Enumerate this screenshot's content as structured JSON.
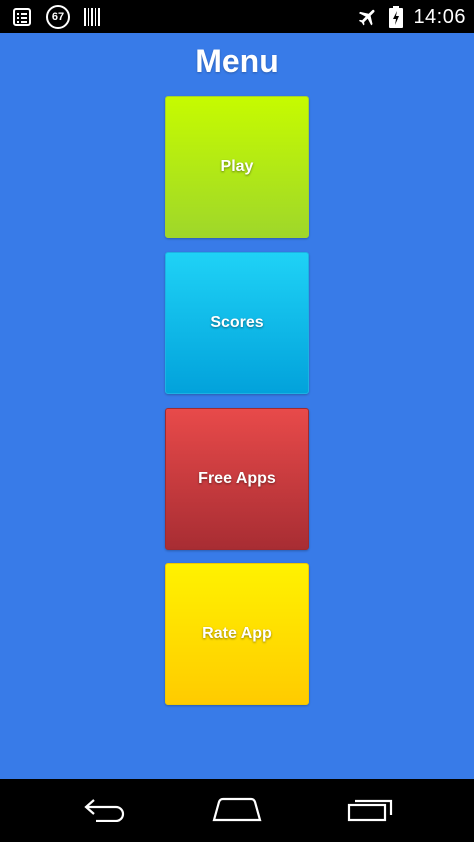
{
  "status_bar": {
    "notification_count": "67",
    "time": "14:06",
    "icons": [
      "notes-icon",
      "notification-count-icon",
      "barcode-icon",
      "airplane-mode-icon",
      "battery-charging-icon"
    ]
  },
  "menu": {
    "title": "Menu",
    "buttons": [
      {
        "label": "Play",
        "color_top": "#c6fb00",
        "color_bottom": "#9fd72a"
      },
      {
        "label": "Scores",
        "color_top": "#1fd2f6",
        "color_bottom": "#02a2db"
      },
      {
        "label": "Free Apps",
        "color_top": "#e84a4a",
        "color_bottom": "#a82d33"
      },
      {
        "label": "Rate App",
        "color_top": "#fff200",
        "color_bottom": "#ffcb00"
      }
    ]
  },
  "navigation": {
    "icons": [
      "back-icon",
      "home-icon",
      "recent-apps-icon"
    ]
  },
  "colors": {
    "background": "#387be8",
    "system_bars": "#000000"
  }
}
